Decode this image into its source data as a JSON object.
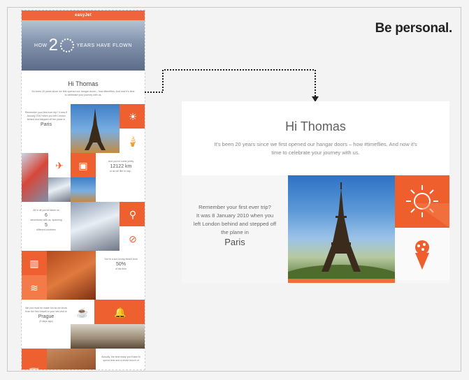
{
  "slide": {
    "headline": "Be personal."
  },
  "email": {
    "brand": "easyJet",
    "hero": {
      "how": "HOW",
      "number": "2",
      "tail": "YEARS HAVE FLOWN"
    },
    "greeting": "Hi Thomas",
    "intro": "It's been 20 years since we first opened our hangar doors – how #timeflies. And now it's time to celebrate your journey with us.",
    "first_trip": {
      "line1": "Remember your first ever trip?",
      "line2": "It was 8 January 2010 when you left London behind and stepped off the plane in",
      "city": "Paris"
    },
    "distance": {
      "line1": "And you've come pretty",
      "value": "12122 km",
      "line2": "or as we like to say..."
    },
    "adventures": {
      "line1": "All in all you've taken on",
      "count": "6",
      "line2": "adventures with us, spanning",
      "countries": "5",
      "line3": "different countries"
    },
    "beach": {
      "line1": "You're a sun-loving beach bum",
      "value": "50%",
      "line2": "of the time"
    },
    "favourite": {
      "line1": "We just must be made fun as we know from the first breath to your last visit to",
      "city": "Prague",
      "line2": "(3 days ago)"
    },
    "closing": {
      "line1": "Actually, the time away you'll take",
      "line2": "to spend time and a whole bunch of"
    }
  },
  "detail": {
    "greeting": "Hi Thomas",
    "intro": "It's been 20 years since we first opened our hangar doors – how #timeflies. And now it's time to celebrate your journey with us.",
    "trip_line1": "Remember your first ever trip?",
    "trip_line2": "It was 8 January 2010 when you",
    "trip_line3": "left London behind and stepped off",
    "trip_line4": "the plane in",
    "city": "Paris"
  },
  "icons": {
    "sun": "sun-icon",
    "ice_cream": "ice-cream-icon",
    "plane": "plane-icon",
    "luggage": "luggage-icon",
    "bike": "bicycle-icon",
    "compass": "compass-icon",
    "building": "building-icon",
    "waves": "waves-icon",
    "cup": "cup-icon",
    "bell": "bell-icon",
    "cocktail": "cocktail-icon"
  },
  "colors": {
    "brand_orange": "#ef6030",
    "background": "#f3f3f3"
  }
}
